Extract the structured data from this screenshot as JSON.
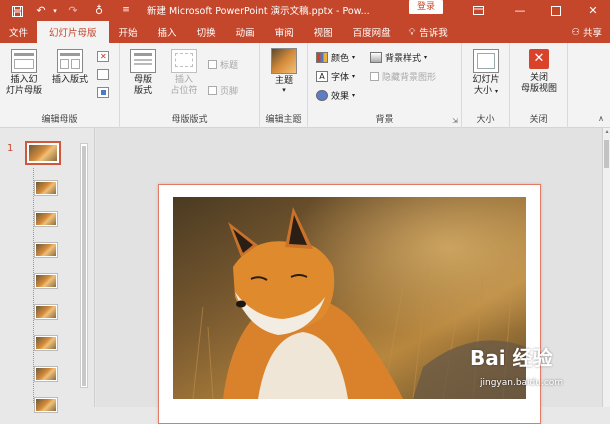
{
  "titlebar": {
    "title": "新建 Microsoft PowerPoint 演示文稿.pptx - Pow...",
    "login": "登录",
    "icons": [
      "save-icon",
      "undo-icon",
      "redo-icon",
      "presenter-icon",
      "customize-icon"
    ]
  },
  "tabs": {
    "file": "文件",
    "slide_master": "幻灯片母版",
    "home": "开始",
    "insert": "插入",
    "transitions": "切换",
    "animations": "动画",
    "review": "审阅",
    "view": "视图",
    "baidu": "百度网盘",
    "tellme": "告诉我",
    "share": "共享"
  },
  "ribbon": {
    "edit_master": {
      "insert_slide_master": "插入幻\n灯片母版",
      "insert_layout": "插入版式",
      "label": "编辑母版"
    },
    "master_layout": {
      "master_layout_btn": "母版\n版式",
      "insert_placeholder": "插入\n占位符",
      "title_chk": "标题",
      "footer_chk": "页脚",
      "label": "母版版式"
    },
    "edit_theme": {
      "theme_btn": "主题",
      "label": "编辑主题"
    },
    "background": {
      "colors": "颜色",
      "fonts": "字体",
      "effects": "效果",
      "bg_styles": "背景样式",
      "hide_bg": "隐藏背景图形",
      "label": "背景"
    },
    "size": {
      "slide_size": "幻灯片\n大小",
      "label": "大小"
    },
    "close": {
      "close_master": "关闭\n母版视图",
      "label": "关闭"
    }
  },
  "thumbnails": {
    "first_number": "1",
    "layout_count": 8
  },
  "watermark": {
    "main": "Bai 经验",
    "sub": "jingyan.baidu.com"
  },
  "colors": {
    "accent": "#c5472b",
    "ribbon_bg": "#f3f3f3",
    "canvas_bg": "#e2e2e2"
  }
}
